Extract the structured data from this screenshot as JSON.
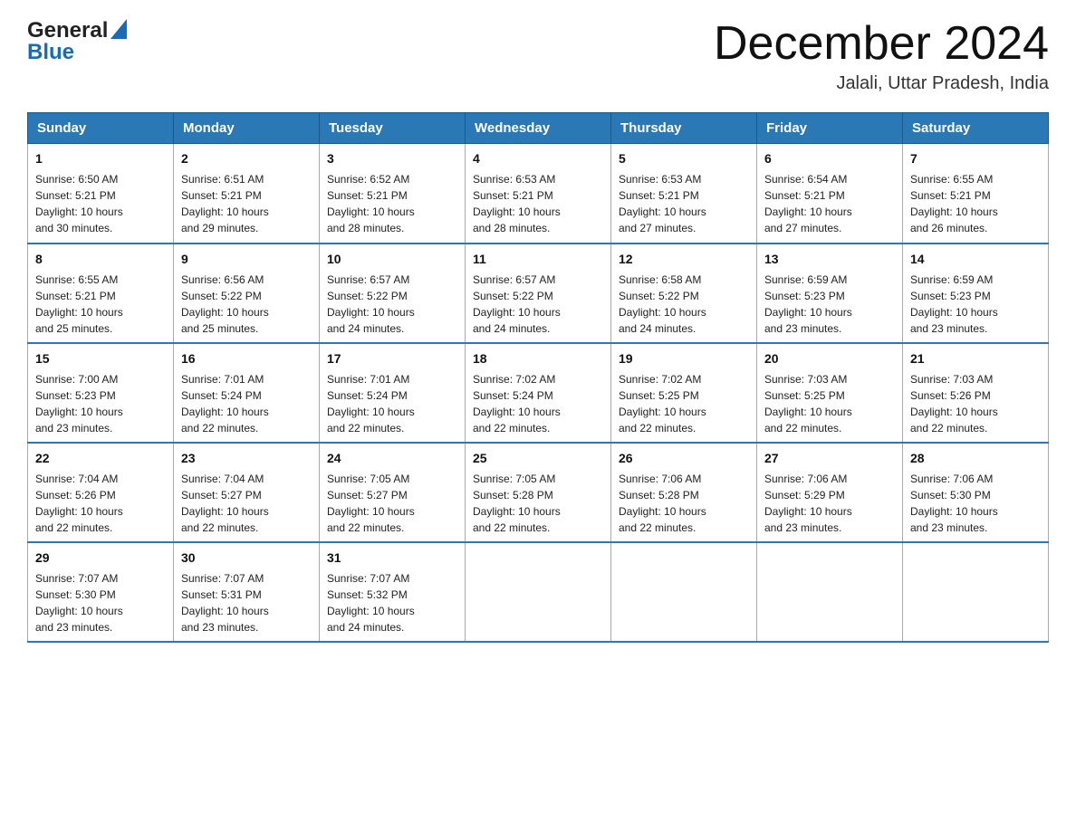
{
  "header": {
    "logo_general": "General",
    "logo_blue": "Blue",
    "month_title": "December 2024",
    "location": "Jalali, Uttar Pradesh, India"
  },
  "weekdays": [
    "Sunday",
    "Monday",
    "Tuesday",
    "Wednesday",
    "Thursday",
    "Friday",
    "Saturday"
  ],
  "weeks": [
    [
      {
        "day": "1",
        "sunrise": "6:50 AM",
        "sunset": "5:21 PM",
        "daylight": "10 hours and 30 minutes."
      },
      {
        "day": "2",
        "sunrise": "6:51 AM",
        "sunset": "5:21 PM",
        "daylight": "10 hours and 29 minutes."
      },
      {
        "day": "3",
        "sunrise": "6:52 AM",
        "sunset": "5:21 PM",
        "daylight": "10 hours and 28 minutes."
      },
      {
        "day": "4",
        "sunrise": "6:53 AM",
        "sunset": "5:21 PM",
        "daylight": "10 hours and 28 minutes."
      },
      {
        "day": "5",
        "sunrise": "6:53 AM",
        "sunset": "5:21 PM",
        "daylight": "10 hours and 27 minutes."
      },
      {
        "day": "6",
        "sunrise": "6:54 AM",
        "sunset": "5:21 PM",
        "daylight": "10 hours and 27 minutes."
      },
      {
        "day": "7",
        "sunrise": "6:55 AM",
        "sunset": "5:21 PM",
        "daylight": "10 hours and 26 minutes."
      }
    ],
    [
      {
        "day": "8",
        "sunrise": "6:55 AM",
        "sunset": "5:21 PM",
        "daylight": "10 hours and 25 minutes."
      },
      {
        "day": "9",
        "sunrise": "6:56 AM",
        "sunset": "5:22 PM",
        "daylight": "10 hours and 25 minutes."
      },
      {
        "day": "10",
        "sunrise": "6:57 AM",
        "sunset": "5:22 PM",
        "daylight": "10 hours and 24 minutes."
      },
      {
        "day": "11",
        "sunrise": "6:57 AM",
        "sunset": "5:22 PM",
        "daylight": "10 hours and 24 minutes."
      },
      {
        "day": "12",
        "sunrise": "6:58 AM",
        "sunset": "5:22 PM",
        "daylight": "10 hours and 24 minutes."
      },
      {
        "day": "13",
        "sunrise": "6:59 AM",
        "sunset": "5:23 PM",
        "daylight": "10 hours and 23 minutes."
      },
      {
        "day": "14",
        "sunrise": "6:59 AM",
        "sunset": "5:23 PM",
        "daylight": "10 hours and 23 minutes."
      }
    ],
    [
      {
        "day": "15",
        "sunrise": "7:00 AM",
        "sunset": "5:23 PM",
        "daylight": "10 hours and 23 minutes."
      },
      {
        "day": "16",
        "sunrise": "7:01 AM",
        "sunset": "5:24 PM",
        "daylight": "10 hours and 22 minutes."
      },
      {
        "day": "17",
        "sunrise": "7:01 AM",
        "sunset": "5:24 PM",
        "daylight": "10 hours and 22 minutes."
      },
      {
        "day": "18",
        "sunrise": "7:02 AM",
        "sunset": "5:24 PM",
        "daylight": "10 hours and 22 minutes."
      },
      {
        "day": "19",
        "sunrise": "7:02 AM",
        "sunset": "5:25 PM",
        "daylight": "10 hours and 22 minutes."
      },
      {
        "day": "20",
        "sunrise": "7:03 AM",
        "sunset": "5:25 PM",
        "daylight": "10 hours and 22 minutes."
      },
      {
        "day": "21",
        "sunrise": "7:03 AM",
        "sunset": "5:26 PM",
        "daylight": "10 hours and 22 minutes."
      }
    ],
    [
      {
        "day": "22",
        "sunrise": "7:04 AM",
        "sunset": "5:26 PM",
        "daylight": "10 hours and 22 minutes."
      },
      {
        "day": "23",
        "sunrise": "7:04 AM",
        "sunset": "5:27 PM",
        "daylight": "10 hours and 22 minutes."
      },
      {
        "day": "24",
        "sunrise": "7:05 AM",
        "sunset": "5:27 PM",
        "daylight": "10 hours and 22 minutes."
      },
      {
        "day": "25",
        "sunrise": "7:05 AM",
        "sunset": "5:28 PM",
        "daylight": "10 hours and 22 minutes."
      },
      {
        "day": "26",
        "sunrise": "7:06 AM",
        "sunset": "5:28 PM",
        "daylight": "10 hours and 22 minutes."
      },
      {
        "day": "27",
        "sunrise": "7:06 AM",
        "sunset": "5:29 PM",
        "daylight": "10 hours and 23 minutes."
      },
      {
        "day": "28",
        "sunrise": "7:06 AM",
        "sunset": "5:30 PM",
        "daylight": "10 hours and 23 minutes."
      }
    ],
    [
      {
        "day": "29",
        "sunrise": "7:07 AM",
        "sunset": "5:30 PM",
        "daylight": "10 hours and 23 minutes."
      },
      {
        "day": "30",
        "sunrise": "7:07 AM",
        "sunset": "5:31 PM",
        "daylight": "10 hours and 23 minutes."
      },
      {
        "day": "31",
        "sunrise": "7:07 AM",
        "sunset": "5:32 PM",
        "daylight": "10 hours and 24 minutes."
      },
      null,
      null,
      null,
      null
    ]
  ],
  "labels": {
    "sunrise": "Sunrise:",
    "sunset": "Sunset:",
    "daylight": "Daylight:"
  }
}
